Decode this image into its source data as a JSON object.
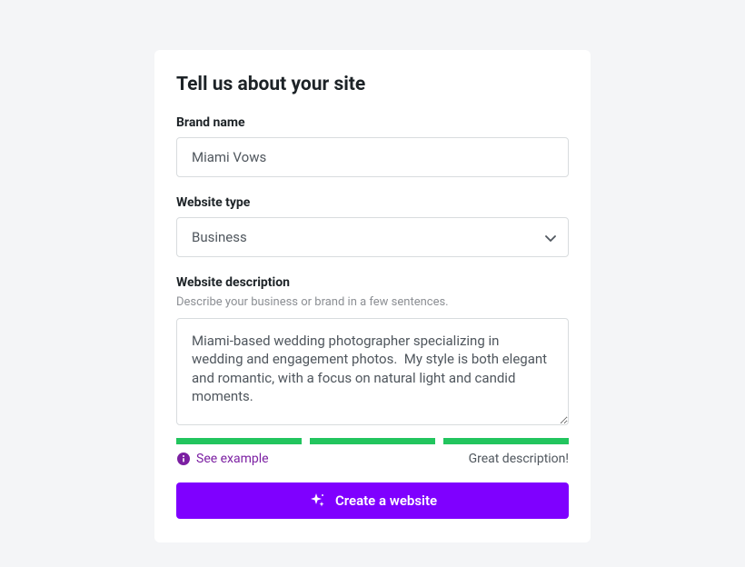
{
  "title": "Tell us about your site",
  "brand": {
    "label": "Brand name",
    "value": "Miami Vows"
  },
  "websiteType": {
    "label": "Website type",
    "selected": "Business"
  },
  "description": {
    "label": "Website description",
    "helper": "Describe your business or brand in a few sentences.",
    "value": "Miami-based wedding photographer specializing in wedding and engagement photos.  My style is both elegant and romantic, with a focus on natural light and candid moments."
  },
  "strength": {
    "example_label": "See example",
    "status": "Great description!"
  },
  "submit": {
    "label": "Create a website"
  },
  "colors": {
    "primary": "#7f00ff",
    "success": "#22c55e",
    "purple_text": "#7b1fa2"
  }
}
